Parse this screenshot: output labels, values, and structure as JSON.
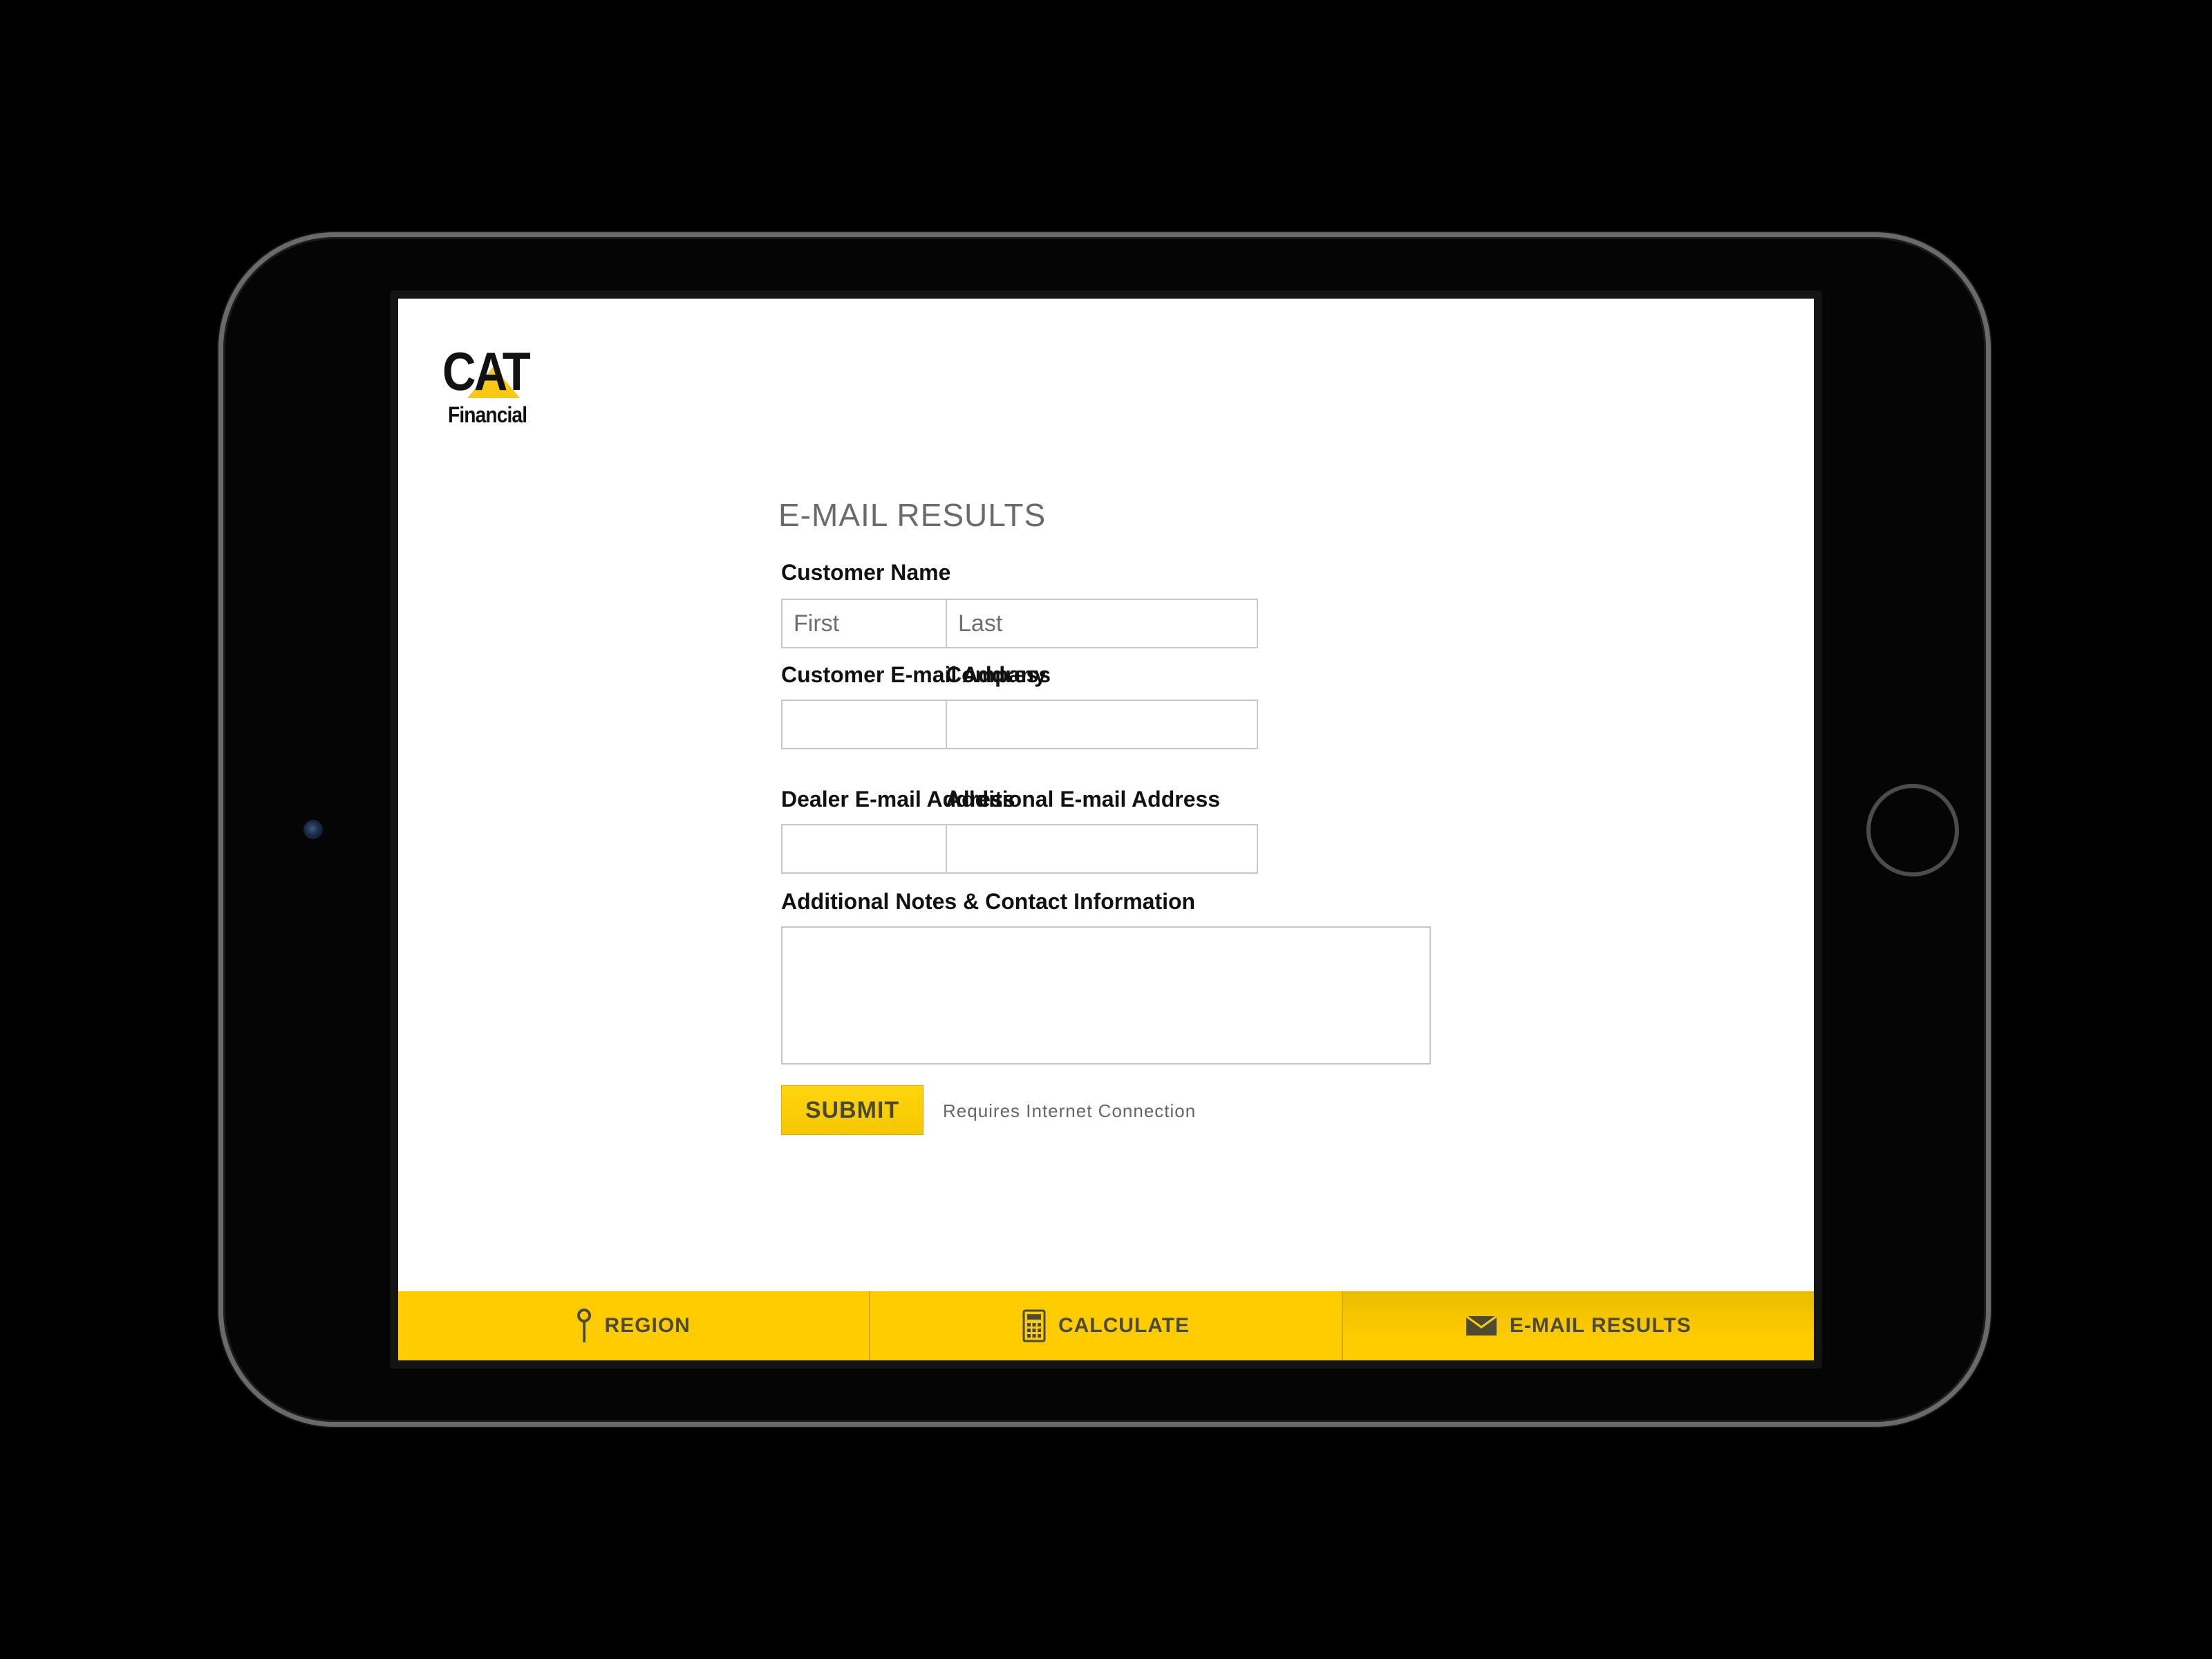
{
  "app": {
    "logo": {
      "brand": "CAT",
      "subtitle": "Financial"
    }
  },
  "form": {
    "title": "E-MAIL RESULTS",
    "customer_name_label": "Customer Name",
    "first_placeholder": "First",
    "last_placeholder": "Last",
    "customer_email_label": "Customer E-mail Address",
    "customer_email_value": "",
    "company_label": "Company",
    "company_value": "",
    "dealer_email_label": "Dealer E-mail Address",
    "dealer_email_value": "",
    "additional_email_label": "Additional E-mail Address",
    "additional_email_value": "",
    "notes_label": "Additional Notes & Contact Information",
    "notes_value": "",
    "submit_label": "SUBMIT",
    "requires_note": "Requires Internet Connection"
  },
  "tabs": [
    {
      "label": "REGION",
      "icon": "pin-icon",
      "active": false
    },
    {
      "label": "CALCULATE",
      "icon": "calculator-icon",
      "active": false
    },
    {
      "label": "E-MAIL RESULTS",
      "icon": "envelope-icon",
      "active": true
    }
  ],
  "colors": {
    "accent_yellow": "#ffcc00",
    "text_dark": "#111111",
    "title_gray": "#6b6b6b"
  }
}
